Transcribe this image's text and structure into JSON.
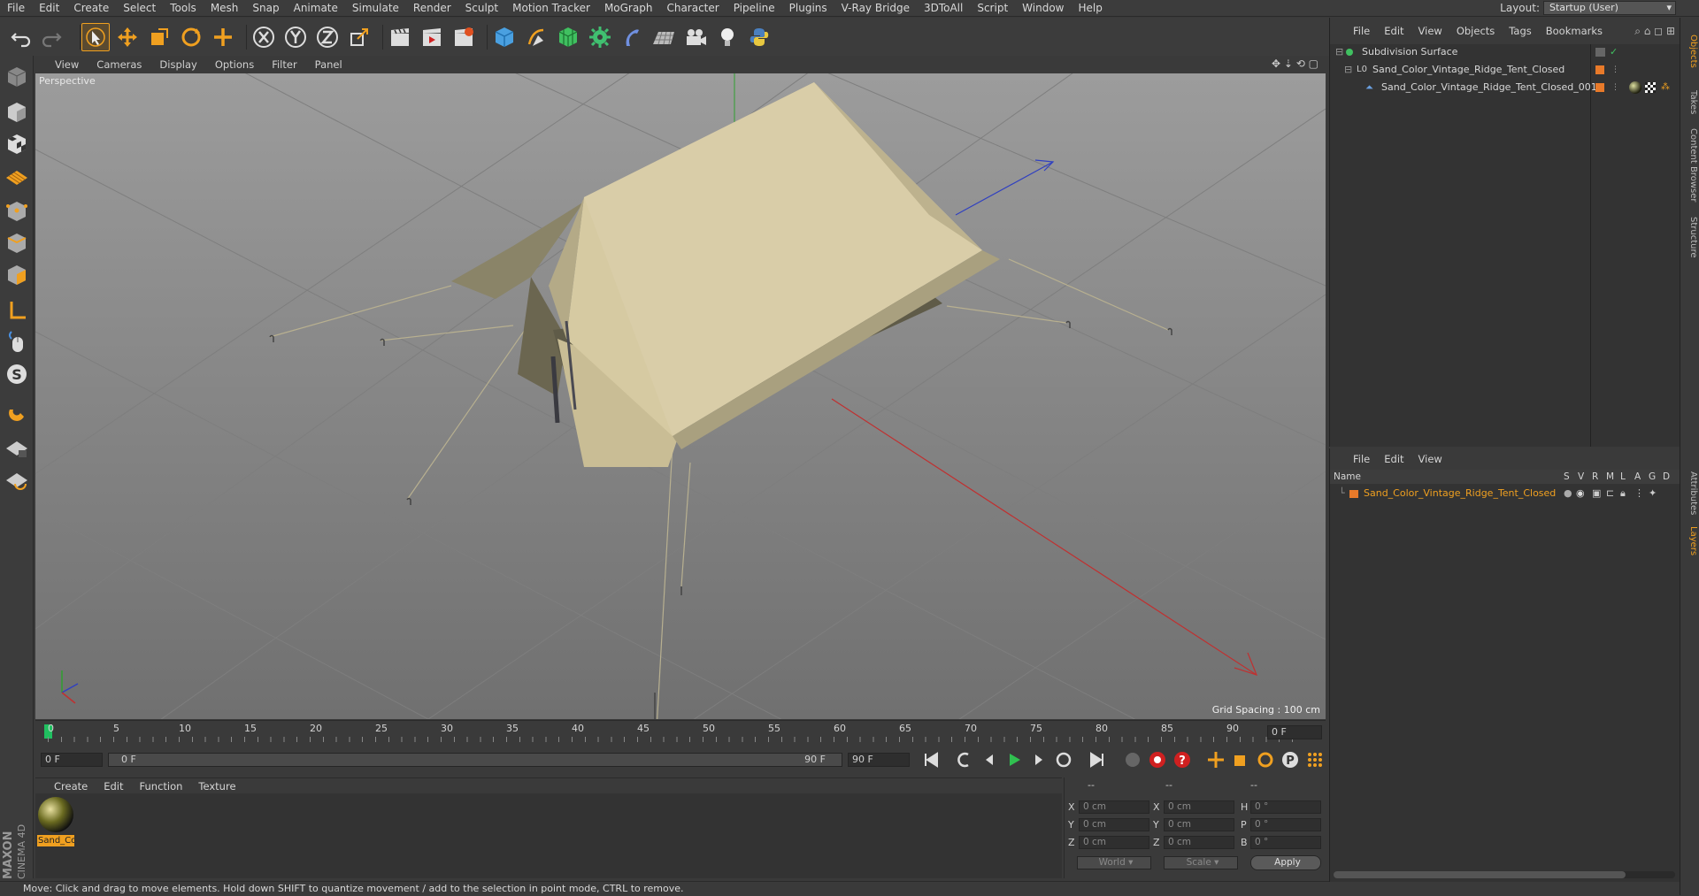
{
  "menu": [
    "File",
    "Edit",
    "Create",
    "Select",
    "Tools",
    "Mesh",
    "Snap",
    "Animate",
    "Simulate",
    "Render",
    "Sculpt",
    "Motion Tracker",
    "MoGraph",
    "Character",
    "Pipeline",
    "Plugins",
    "V-Ray Bridge",
    "3DToAll",
    "Script",
    "Window",
    "Help"
  ],
  "layout": {
    "label": "Layout:",
    "value": "Startup (User)"
  },
  "viewport": {
    "menu": [
      "View",
      "Cameras",
      "Display",
      "Options",
      "Filter",
      "Panel"
    ],
    "camera_label": "Perspective",
    "grid_spacing": "Grid Spacing : 100 cm"
  },
  "timeline": {
    "ticks": [
      "0",
      "5",
      "10",
      "15",
      "20",
      "25",
      "30",
      "35",
      "40",
      "45",
      "50",
      "55",
      "60",
      "65",
      "70",
      "75",
      "80",
      "85",
      "90"
    ],
    "current_frame": "0 F",
    "start_frame": "0 F",
    "range_start": "0 F",
    "range_end": "90 F",
    "end_frame": "90 F"
  },
  "material_manager": {
    "menu": [
      "Create",
      "Edit",
      "Function",
      "Texture"
    ],
    "material_name": "Sand_Co"
  },
  "coordinates": {
    "headers": [
      "--",
      "--",
      "--"
    ],
    "rows": [
      {
        "a": "X",
        "av": "0 cm",
        "b": "X",
        "bv": "0 cm",
        "c": "H",
        "cv": "0 °"
      },
      {
        "a": "Y",
        "av": "0 cm",
        "b": "Y",
        "bv": "0 cm",
        "c": "P",
        "cv": "0 °"
      },
      {
        "a": "Z",
        "av": "0 cm",
        "b": "Z",
        "bv": "0 cm",
        "c": "B",
        "cv": "0 °"
      }
    ],
    "mode": "World",
    "scale": "Scale",
    "apply": "Apply"
  },
  "object_manager": {
    "menu": [
      "File",
      "Edit",
      "View",
      "Objects",
      "Tags",
      "Bookmarks"
    ],
    "objects": [
      {
        "name": "Subdivision Surface"
      },
      {
        "name": "Sand_Color_Vintage_Ridge_Tent_Closed"
      },
      {
        "name": "Sand_Color_Vintage_Ridge_Tent_Closed_001"
      }
    ]
  },
  "layer_manager": {
    "menu": [
      "File",
      "Edit",
      "View"
    ],
    "header": {
      "name": "Name",
      "cols": [
        "S",
        "V",
        "R",
        "M",
        "L",
        "A",
        "G",
        "D"
      ]
    },
    "layers": [
      {
        "name": "Sand_Color_Vintage_Ridge_Tent_Closed",
        "color": "#e87a2a"
      }
    ]
  },
  "right_tabs": [
    "Objects",
    "Takes",
    "Content Browser",
    "Structure",
    "Attributes",
    "Layers"
  ],
  "status": "Move: Click and drag to move elements. Hold down SHIFT to quantize movement / add to the selection in point mode, CTRL to remove.",
  "brand": {
    "line1": "MAXON",
    "line2": "CINEMA 4D"
  },
  "colors": {
    "accent": "#f0a020",
    "selection": "#f0a020",
    "tent": "#d9cda8"
  }
}
